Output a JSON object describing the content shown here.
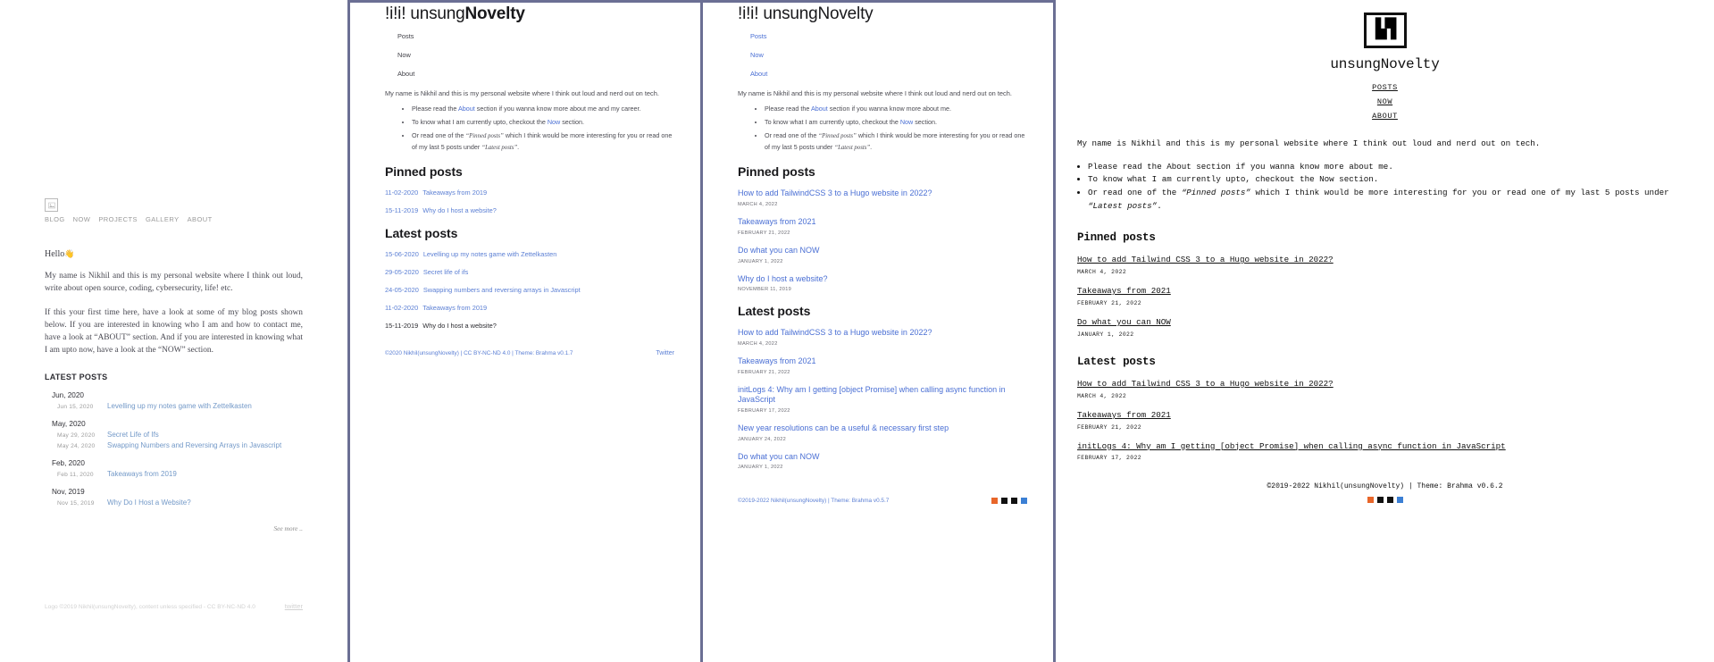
{
  "panel1": {
    "logo_icon": "image-placeholder-icon",
    "nav": [
      "BLOG",
      "NOW",
      "PROJECTS",
      "GALLERY",
      "ABOUT"
    ],
    "greeting": "Hello",
    "greeting_emoji": "👋",
    "paragraph1": "My name is Nikhil and this is my personal website where I think out loud, write about open source, coding, cybersecurity, life! etc.",
    "paragraph2": "If this your first time here, have a look at some of my blog posts shown below. If you are interested in knowing who I am and how to contact me, have a look at “ABOUT” section. And if you are interested in knowing what I am upto now, have a look at the “NOW” section.",
    "latest_heading": "LATEST POSTS",
    "groups": [
      {
        "month": "Jun, 2020",
        "posts": [
          {
            "date": "Jun 15, 2020",
            "title": "Levelling up my notes game with Zettelkasten"
          }
        ]
      },
      {
        "month": "May, 2020",
        "posts": [
          {
            "date": "May 29, 2020",
            "title": "Secret Life of Ifs"
          },
          {
            "date": "May 24, 2020",
            "title": "Swapping Numbers and Reversing Arrays in Javascript"
          }
        ]
      },
      {
        "month": "Feb, 2020",
        "posts": [
          {
            "date": "Feb 11, 2020",
            "title": "Takeaways from 2019"
          }
        ]
      },
      {
        "month": "Nov, 2019",
        "posts": [
          {
            "date": "Nov 15, 2019",
            "title": "Why Do I Host a Website?"
          }
        ]
      }
    ],
    "see_more": "See more ..",
    "footer_license": "Logo ©2019 Nikhil(unsungNovelty), content unless specified - CC BY-NC-ND 4.0",
    "footer_twitter": "twitter"
  },
  "panel2": {
    "title_prefix": "!i!i! unsung",
    "title_bold": "Novelty",
    "nav": [
      "Posts",
      "Now",
      "About"
    ],
    "intro": "My name is Nikhil and this is my personal website where I think out loud and nerd out on tech.",
    "bullets": [
      {
        "pre": "Please read the ",
        "link": "About",
        "post": " section if you wanna know more about me and my career."
      },
      {
        "pre": "To know what I am currently upto, checkout the ",
        "link": "Now",
        "post": " section."
      },
      {
        "pre": "Or read one of the ",
        "em1": "“Pinned posts”",
        "mid": " which I think would be more interesting for you or read one of my last 5 posts under ",
        "em2": "“Latest posts”",
        "post": "."
      }
    ],
    "pinned_heading": "Pinned posts",
    "pinned": [
      {
        "date": "11-02-2020",
        "title": "Takeaways from 2019"
      },
      {
        "date": "15-11-2019",
        "title": "Why do I host a website?"
      }
    ],
    "latest_heading": "Latest posts",
    "latest": [
      {
        "date": "15-06-2020",
        "title": "Levelling up my notes game with Zettelkasten",
        "muted": false
      },
      {
        "date": "29-05-2020",
        "title": "Secret life of ifs",
        "muted": false
      },
      {
        "date": "24-05-2020",
        "title": "Swapping numbers and reversing arrays in Javascript",
        "muted": false
      },
      {
        "date": "11-02-2020",
        "title": "Takeaways from 2019",
        "muted": false
      },
      {
        "date": "15-11-2019",
        "title": "Why do I host a website?",
        "muted": true
      }
    ],
    "footer_copy": "©2020 Nikhil(unsungNovelty) | CC BY-NC-ND 4.0 | Theme: Brahma v0.1.7",
    "footer_link": "Twitter"
  },
  "panel3": {
    "title_prefix": "!i!i! unsung",
    "title_bold": "Novelty",
    "title_full": "!i!i! unsungNovelty",
    "nav": [
      "Posts",
      "Now",
      "About"
    ],
    "intro": "My name is Nikhil and this is my personal website where I think out loud and nerd out on tech.",
    "bullets": [
      {
        "pre": "Please read the ",
        "link": "About",
        "post": " section if you wanna know more about me."
      },
      {
        "pre": "To know what I am currently upto, checkout the ",
        "link": "Now",
        "post": " section."
      },
      {
        "pre": "Or read one of the ",
        "em1": "“Pinned posts”",
        "mid": " which I think would be more interesting for you or read one of my last 5 posts under ",
        "em2": "“Latest posts”",
        "post": "."
      }
    ],
    "pinned_heading": "Pinned posts",
    "pinned": [
      {
        "title": "How to add TailwindCSS 3 to a Hugo website in 2022?",
        "meta": "MARCH 4, 2022"
      },
      {
        "title": "Takeaways from 2021",
        "meta": "FEBRUARY 21, 2022"
      },
      {
        "title": "Do what you can NOW",
        "meta": "JANUARY 1, 2022"
      },
      {
        "title": "Why do I host a website?",
        "meta": "NOVEMBER 11, 2019"
      }
    ],
    "latest_heading": "Latest posts",
    "latest": [
      {
        "title": "How to add TailwindCSS 3 to a Hugo website in 2022?",
        "meta": "MARCH 4, 2022"
      },
      {
        "title": "Takeaways from 2021",
        "meta": "FEBRUARY 21, 2022"
      },
      {
        "title": "initLogs 4: Why am I getting [object Promise] when calling async function in JavaScript",
        "meta": "FEBRUARY 17, 2022"
      },
      {
        "title": "New year resolutions can be a useful & necessary first step",
        "meta": "JANUARY 24, 2022"
      },
      {
        "title": "Do what you can NOW",
        "meta": "JANUARY 1, 2022"
      }
    ],
    "footer_copy": "©2019-2022 Nikhil(unsungNovelty) | Theme: Brahma v0.5.7",
    "social_icons": [
      "mastodon-icon",
      "medium-icon",
      "twitter-icon",
      "rss-icon"
    ]
  },
  "panel4": {
    "logo_glyph": "■■",
    "logo_icon": "unsungnovelty-logo-icon",
    "brand": "unsungNovelty",
    "nav": [
      "POSTS",
      "NOW",
      "ABOUT"
    ],
    "intro": "My name is Nikhil and this is my personal website where I think out loud and nerd out on tech.",
    "bullets": [
      {
        "pre": "Please read the About section if you wanna know more about me."
      },
      {
        "pre": "To know what I am currently upto, checkout the Now section."
      },
      {
        "pre": "Or read one of the ",
        "em1": "“Pinned posts”",
        "mid": " which I think would be more interesting for you or read one of my last 5 posts under ",
        "em2": "“Latest posts”",
        "post": "."
      }
    ],
    "pinned_heading": "Pinned posts",
    "pinned": [
      {
        "title": "How to add Tailwind CSS 3 to a Hugo website in 2022?",
        "meta": "MARCH 4, 2022"
      },
      {
        "title": "Takeaways from 2021",
        "meta": "FEBRUARY 21, 2022"
      },
      {
        "title": "Do what you can NOW",
        "meta": "JANUARY 1, 2022"
      }
    ],
    "latest_heading": "Latest posts",
    "latest": [
      {
        "title": "How to add Tailwind CSS 3 to a Hugo website in 2022?",
        "meta": "MARCH 4, 2022"
      },
      {
        "title": "Takeaways from 2021",
        "meta": "FEBRUARY 21, 2022"
      },
      {
        "title": "initLogs 4: Why am I getting [object Promise] when calling async function in JavaScript",
        "meta": "FEBRUARY 17, 2022"
      }
    ],
    "footer_copy": "©2019-2022 Nikhil(unsungNovelty) | Theme: Brahma v0.6.2",
    "social_icons": [
      "mastodon-icon",
      "medium-icon",
      "twitter-icon",
      "rss-icon"
    ]
  },
  "colors": {
    "link_blue": "#4a6fd4",
    "soft_blue": "#7399c8",
    "separator": "#6b6f94",
    "muted": "#9a9a9a",
    "ink": "#18181b"
  }
}
